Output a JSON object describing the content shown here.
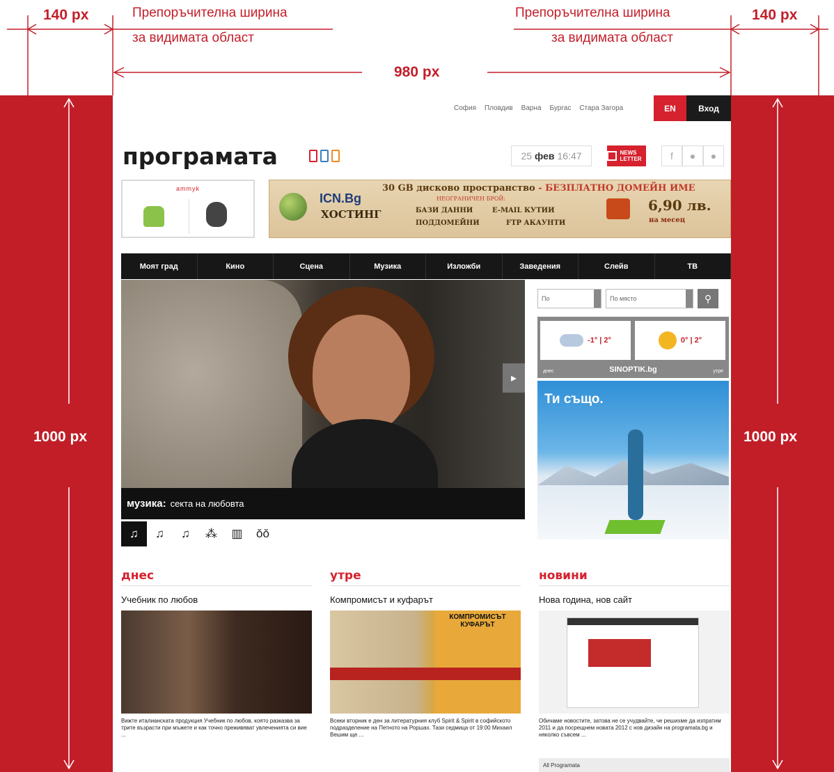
{
  "annotations": {
    "margin_label_left": "140 px",
    "margin_label_right": "140 px",
    "width_label": "980 px",
    "height_label_left": "1000 px",
    "height_label_right": "1000 px",
    "recommended_left_line1": "Препоръчителна ширина",
    "recommended_left_line2": "за видимата област",
    "recommended_right_line1": "Препоръчителна ширина",
    "recommended_right_line2": "за видимата област",
    "accent_color": "#c21f2a"
  },
  "site": {
    "cities": [
      "София",
      "Пловдив",
      "Варна",
      "Бургас",
      "Стара Загора"
    ],
    "lang_button": "EN",
    "login_button": "Вход",
    "logo": "програмата",
    "date_day": "25",
    "date_month": "фев",
    "date_time": "16:47",
    "newsletter": "NEWS LETTER",
    "social": [
      "f",
      "",
      ""
    ],
    "apps_label": "ammyk",
    "banner": {
      "headline": "30 GB дисково пространство",
      "headline_red": " - БЕЗПЛАТНО ДОМЕЙН ИМЕ",
      "sub": "НЕОГРАНИЧЕН БРОЙ:",
      "brand": "ICN.Bg",
      "hosting": "ХОСТИНГ",
      "f1": "БАЗИ ДАННИ",
      "f2": "E-MAIL КУТИИ",
      "f3": "ПОДДОМЕЙНИ",
      "f4": "FTP АКАУНТИ",
      "price": "6,90 лв.",
      "per": "на месец"
    },
    "nav": [
      "Моят град",
      "Кино",
      "Сцена",
      "Музика",
      "Изложби",
      "Заведения",
      "Слейв",
      "ТВ"
    ],
    "hero_category": "музика:",
    "hero_title": "секта на любовта",
    "hero_arrow": "▸",
    "category_icons": [
      "♫",
      "♫",
      "♫",
      "⁂",
      "▥",
      "ǒǒ"
    ],
    "search_select1": "По",
    "search_select2": "По място",
    "search_icon": "⚲",
    "weather": {
      "today_label": "днес",
      "tomorrow_label": "утре",
      "today_temp": "-1° | 2°",
      "tomorrow_temp": "0° | 2°",
      "provider": "SINOPTIK.bg"
    },
    "ad_title": "Ти също.",
    "sections": [
      {
        "title": "днес",
        "headline": "Учебник по любов",
        "text": "Вижте италианската продукция Учебник по любов, която разказва за трите възрасти при мъжете и как точно преживяват увлеченията си вие ..."
      },
      {
        "title": "утре",
        "headline": "Компромисът и куфарът",
        "book_title": "КОМПРОМИСЪТ КУФАРЪТ",
        "text": "Всеки вторник е ден за литературния клуб Spirit & Spirit в софийското подразделение на Петното на Роршах. Тази седмица от 19:00 Михаил Вешим ще ..."
      },
      {
        "title": "новини",
        "headline": "Нова година, нов сайт",
        "text": "Обичаме новостите, затова не се учудвайте, че решихме да изпратим 2011 и да посрещнем новата 2012 с нов дизайн на programata.bg и няколко съвсем ..."
      }
    ],
    "bottom_strip": "All Programata"
  }
}
